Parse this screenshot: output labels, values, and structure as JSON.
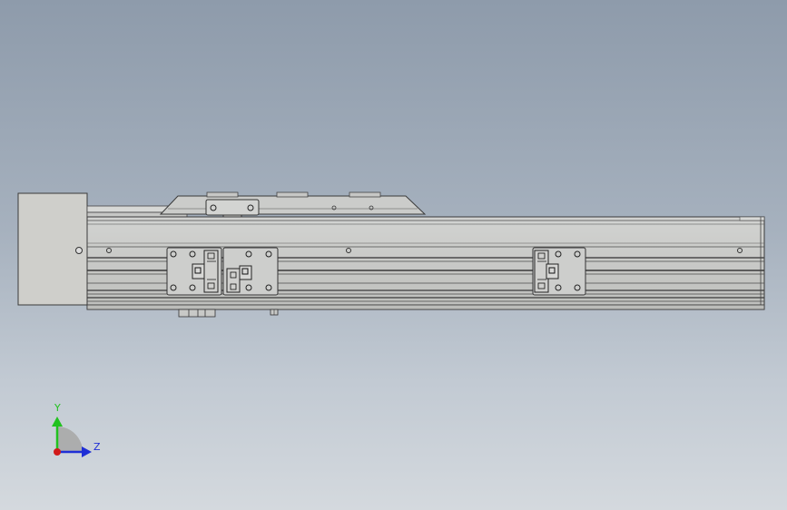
{
  "viewport": {
    "background_top": "#8e9bab",
    "background_bottom": "#d4d9de"
  },
  "triad": {
    "y_label": "Y",
    "z_label": "Z",
    "x_color": "#d11a1a",
    "y_color": "#21c21f",
    "z_color": "#1f2fd6"
  },
  "model": {
    "part_fill": "#c9cac8",
    "part_stroke": "#3a3a3a",
    "motor_fill": "#cfcfcb"
  }
}
